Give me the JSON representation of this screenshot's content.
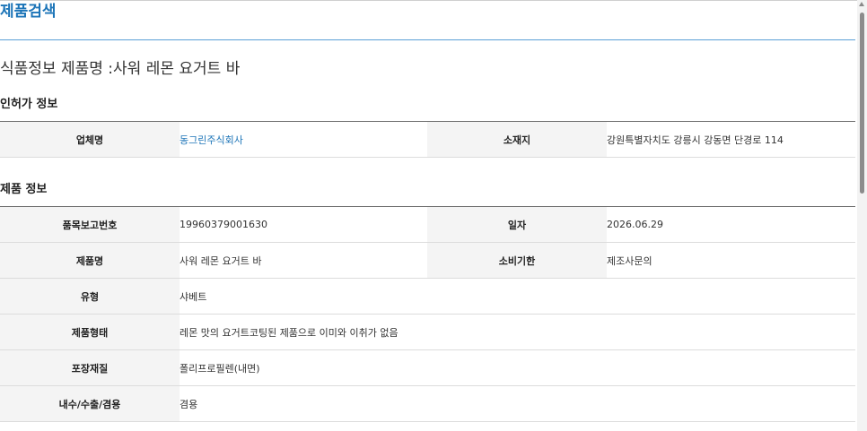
{
  "header": {
    "title": "제품검색"
  },
  "product_heading": "식품정보 제품명 :사워 레몬 요거트 바",
  "license_section": {
    "title": "인허가 정보",
    "company_label": "업체명",
    "company_value": "동그린주식회사",
    "location_label": "소재지",
    "location_value": "강원특별자치도 강릉시 강동면 단경로 114"
  },
  "product_section": {
    "title": "제품 정보",
    "report_no_label": "품목보고번호",
    "report_no_value": "19960379001630",
    "date_label": "일자",
    "date_value": "2026.06.29",
    "name_label": "제품명",
    "name_value": "사워 레몬 요거트 바",
    "expiry_label": "소비기한",
    "expiry_value": "제조사문의",
    "type_label": "유형",
    "type_value": "샤베트",
    "form_label": "제품형태",
    "form_value": "레몬 맛의 요거트코팅된 제품으로 이미와 이취가 없음",
    "packaging_label": "포장재질",
    "packaging_value": "폴리프로필렌(내면)",
    "market_label": "내수/수출/겸용",
    "market_value": "겸용"
  },
  "colors": {
    "accent": "#1d75b8",
    "label_bg": "#f4f4f4",
    "rule": "#5a9fd6"
  }
}
